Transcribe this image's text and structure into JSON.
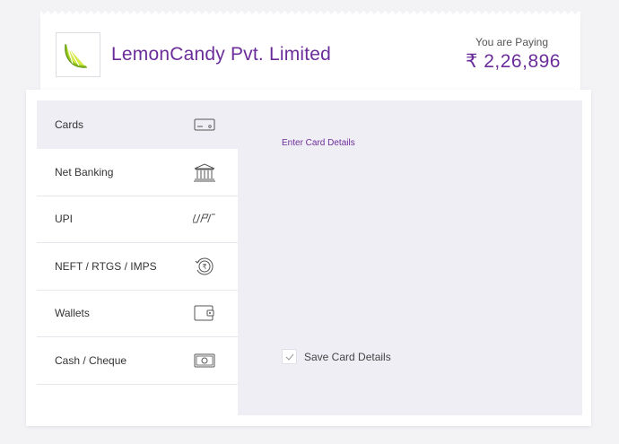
{
  "merchant": {
    "name": "LemonCandy Pvt. Limited",
    "paying_label": "You are Paying",
    "amount": "₹ 2,26,896"
  },
  "methods": [
    {
      "label": "Cards",
      "icon": "card-icon",
      "active": true
    },
    {
      "label": "Net Banking",
      "icon": "bank-icon",
      "active": false
    },
    {
      "label": "UPI",
      "icon": "upi-icon",
      "active": false
    },
    {
      "label": "NEFT / RTGS / IMPS",
      "icon": "rupee-transfer-icon",
      "active": false
    },
    {
      "label": "Wallets",
      "icon": "wallet-icon",
      "active": false
    },
    {
      "label": "Cash / Cheque",
      "icon": "cash-icon",
      "active": false
    }
  ],
  "card_form": {
    "title": "Enter Card Details",
    "save_label": "Save Card Details",
    "save_checked": true
  },
  "colors": {
    "accent": "#6b2d9a",
    "active_bg": "#f0eef5"
  }
}
